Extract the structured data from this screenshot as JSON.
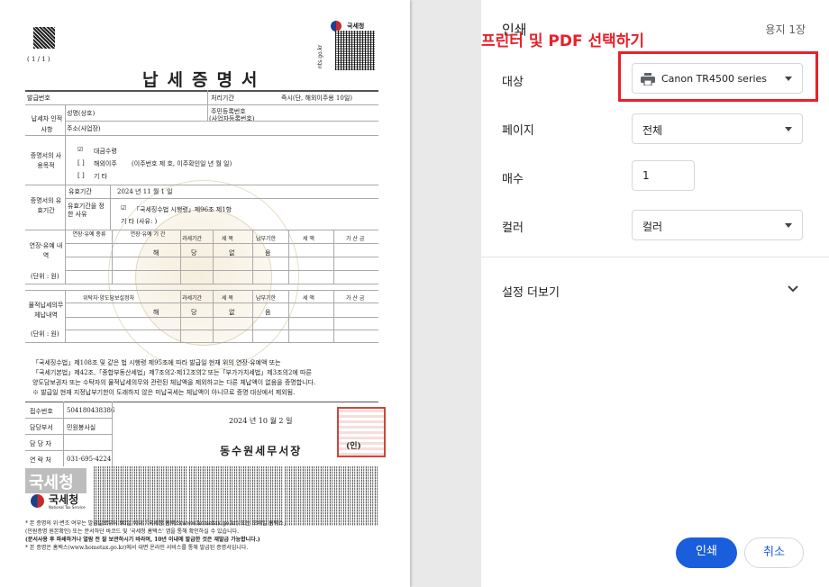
{
  "dialog": {
    "title": "인쇄",
    "sheet_count": "용지 1장",
    "annotation": "프린터 및 PDF 선택하기",
    "annotation_color": "#e8202a",
    "destination": {
      "label": "대상",
      "value": "Canon TR4500 series",
      "icon": "printer-icon"
    },
    "pages": {
      "label": "페이지",
      "value": "전체"
    },
    "copies": {
      "label": "매수",
      "value": "1"
    },
    "color": {
      "label": "컬러",
      "value": "컬러"
    },
    "more_settings": {
      "label": "설정 더보기",
      "icon": "chevron-down-icon"
    },
    "print_button": "인쇄",
    "cancel_button": "취소",
    "accent_color": "#1a5edb"
  },
  "document": {
    "page_indicator": "( 1 / 1 )",
    "title": "납세증명서",
    "nts_logo_text": "국세청",
    "nts_side_text": "nts.go.kr",
    "rows": {
      "issue_no": "발급번호",
      "process_period": "처리기간",
      "process_period_value": "즉시(단, 해외이주용 10일)",
      "taxpayer": "납세자 인적사항",
      "name": "성명(상호)",
      "resident_no": "주민등록번호",
      "business_no": "(사업자등록번호)",
      "address": "주소(사업장)",
      "purpose": "증명서의 사용목적",
      "purpose_opt1": "대금수령",
      "purpose_opt2": "해외이주",
      "purpose_opt2_detail": "(이주번호 제          호, 이주확인일          년    월    일)",
      "purpose_opt3": "기 타",
      "validity": "증명서의 유효기간",
      "valid_period": "유효기간",
      "valid_period_value": "2024 년  11 월  1 일",
      "valid_reason": "유효기간을 정한 사유",
      "valid_reason_opt1": "「국세징수법 시행령」제96조 제1항",
      "valid_reason_opt2": "기 타 (사유:                    )",
      "extension": "연장·유예 내역",
      "extension_unit": "(단위 : 원)",
      "cols_a": [
        "연장·유예 종류",
        "연장·유예 기 간",
        "과세기간",
        "세 목",
        "납부기한",
        "세 액",
        "가 산 금"
      ],
      "none_text": [
        "해",
        "당",
        "없",
        "음"
      ],
      "seizure": "물적납세의무 체납내역",
      "seizure_unit": "(단위 : 원)",
      "cols_b": [
        "위탁자·양도담보설정자",
        "과세기간",
        "세 목",
        "납부기한",
        "세 액",
        "가 산 금"
      ]
    },
    "statement": [
      "「국세징수법」제108조 및 같은 법 시행령 제95조에 따라 발급일 현재 위의 연장·유예액 또는",
      "「국세기본법」제42조,「종합부동산세법」제7조의2·제12조의2 또는「부가가치세법」제3조의2에 따른",
      "양도담보권자 또는 수탁자의 물적납세의무와 관련된 체납액을 제외하고는 다른 체납액이 없음을 증명합니다.",
      "※ 발급일 현재 지정납부기한이 도래하지 않은 미납국세는 체납액이 아니므로 증명 대상에서 제외됨."
    ],
    "receipt_label": "접수번호",
    "receipt_no": "504180438386",
    "dept_label": "담당부서",
    "dept_value": "민원봉사실",
    "officer_label": "담 당 자",
    "phone_label": "연 락 처",
    "phone_value": "031-695-4224",
    "issue_date": "2024 년  10 월  2 일",
    "office": "동수원세무서장",
    "seal_mark": "(인)",
    "stamp_label": "국세청",
    "nts_brand": "국세청",
    "nts_brand_en": "National Tax Service",
    "footnotes": [
      "* 본 증명의 위·변조 여부는 발급일로부터 90일 이내「국세청 홈택스(www.hometax.go.kr) 또는 모바일 홈택스」",
      "  (민원증명 원본확인) 또는 문서하단 바코드 및 '국세청 홈택스' 앱을 통해 확인하실 수 있습니다.",
      "  (문서사용 후 파쇄하거나 열람 전 잘 보관하시기 바라며, 10년 이내에 발급한 것은 재발급 가능합니다.)",
      "* 본 증명은 홈택스(www.hometax.go.kr)에서 대면 온라인 서비스를 통해 발급된 증명서입니다."
    ]
  }
}
